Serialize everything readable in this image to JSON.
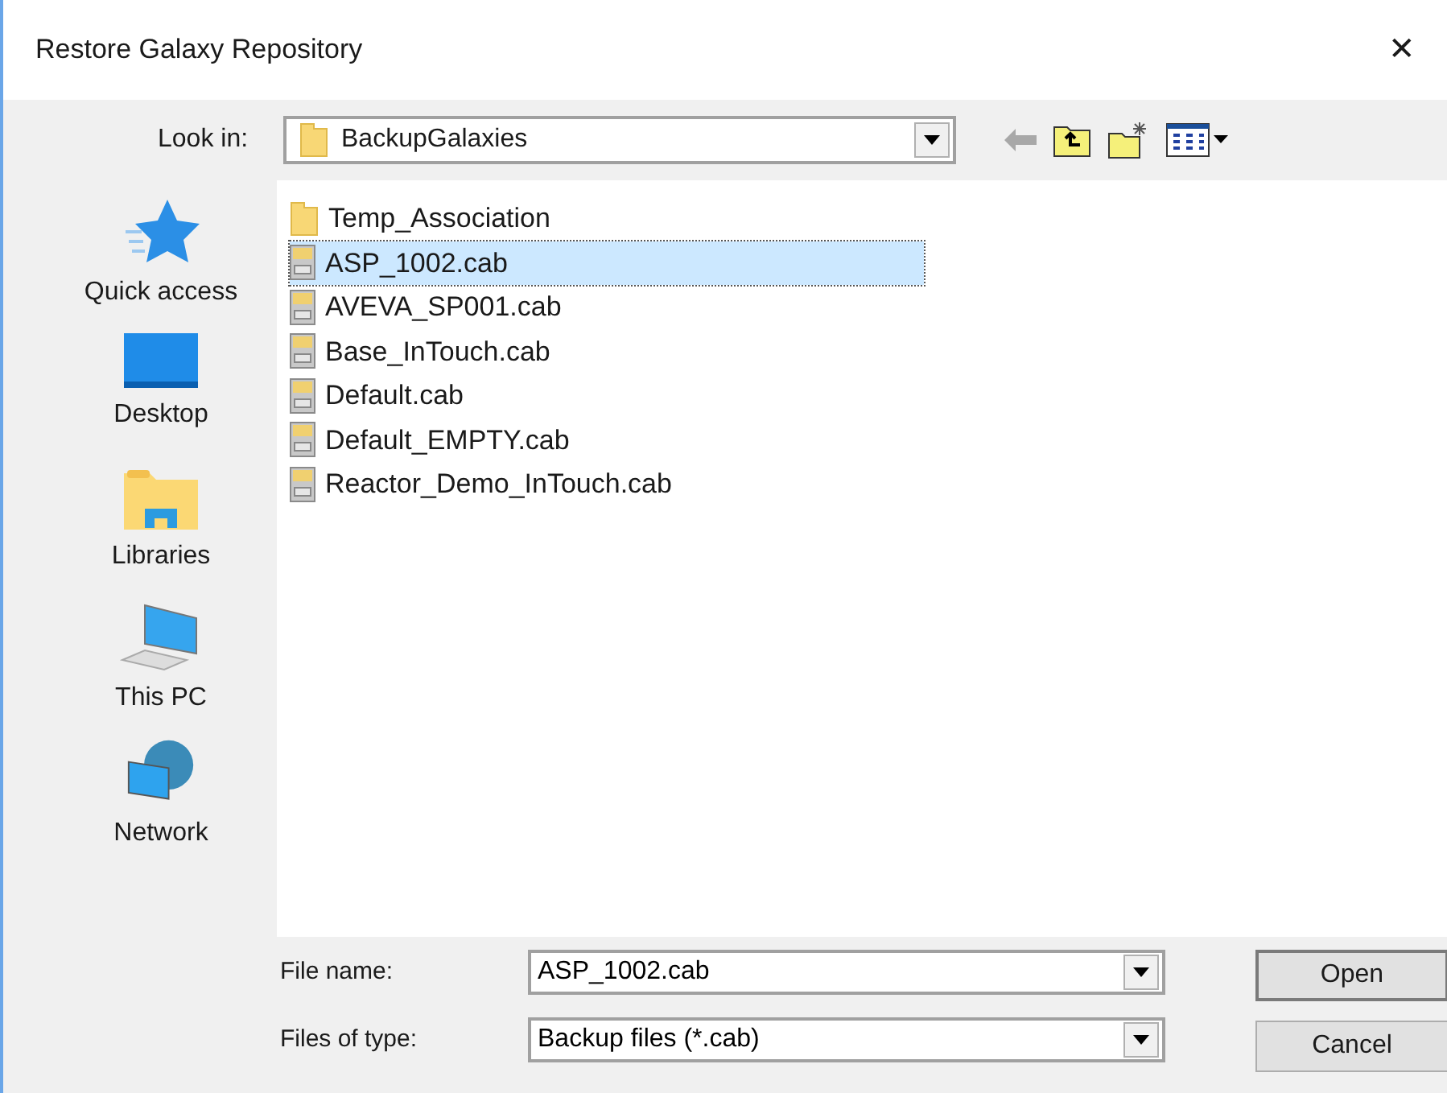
{
  "window": {
    "title": "Restore Galaxy Repository",
    "close": "✕"
  },
  "look_in": {
    "label": "Look in:",
    "value": "BackupGalaxies",
    "back_disabled": true
  },
  "places": [
    {
      "kind": "quick",
      "label": "Quick access"
    },
    {
      "kind": "desktop",
      "label": "Desktop"
    },
    {
      "kind": "libraries",
      "label": "Libraries"
    },
    {
      "kind": "pc",
      "label": "This PC"
    },
    {
      "kind": "network",
      "label": "Network"
    }
  ],
  "files": [
    {
      "kind": "folder",
      "name": "Temp_Association",
      "selected": false
    },
    {
      "kind": "cab",
      "name": "ASP_1002.cab",
      "selected": true
    },
    {
      "kind": "cab",
      "name": "AVEVA_SP001.cab",
      "selected": false
    },
    {
      "kind": "cab",
      "name": "Base_InTouch.cab",
      "selected": false
    },
    {
      "kind": "cab",
      "name": "Default.cab",
      "selected": false
    },
    {
      "kind": "cab",
      "name": "Default_EMPTY.cab",
      "selected": false
    },
    {
      "kind": "cab",
      "name": "Reactor_Demo_InTouch.cab",
      "selected": false
    }
  ],
  "file_name": {
    "label": "File name:",
    "value": "ASP_1002.cab"
  },
  "file_type": {
    "label": "Files of type:",
    "value": "Backup files (*.cab)"
  },
  "buttons": [
    "Open",
    "Cancel"
  ]
}
